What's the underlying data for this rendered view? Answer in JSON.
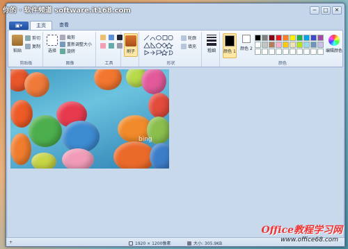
{
  "watermark": {
    "top": "你的 · 软件频道 software.it168.com",
    "brand": "Office教程学习网",
    "url": "www.office68.com"
  },
  "window": {
    "controls": [
      "─",
      "□",
      "✕"
    ]
  },
  "tabs": {
    "menu_label": "▣▾",
    "home": "主页",
    "view": "查看"
  },
  "ribbon": {
    "clipboard": {
      "paste": "粘贴",
      "cut": "剪切",
      "copy": "复制",
      "label": "剪贴板"
    },
    "image": {
      "select": "选择",
      "crop": "裁剪",
      "resize": "重新调整大小",
      "rotate": "旋转",
      "label": "图像"
    },
    "tools": {
      "label": "工具"
    },
    "brushes": {
      "label": "刷子"
    },
    "shapes": {
      "outline": "轮廓",
      "fill": "填充",
      "label": "形状"
    },
    "size": {
      "label": "粗细"
    },
    "colors": {
      "color1": "颜色 1",
      "color2": "颜色 2",
      "edit": "编辑颜色",
      "label": "颜色"
    }
  },
  "palette": [
    "#000000",
    "#7f7f7f",
    "#880015",
    "#ed1c24",
    "#ff7f27",
    "#fff200",
    "#22b14c",
    "#00a2e8",
    "#3f48cc",
    "#a349a4",
    "#ffffff",
    "#c3c3c3",
    "#b97a57",
    "#ffaec9",
    "#ffc90e",
    "#efe4b0",
    "#b5e61d",
    "#99d9ea",
    "#7092be",
    "#c8bfe7",
    "#ffffff",
    "#ffffff",
    "#ffffff",
    "#ffffff",
    "#ffffff",
    "#ffffff",
    "#ffffff",
    "#ffffff",
    "#ffffff",
    "#ffffff"
  ],
  "image": {
    "bing_text": "bing"
  },
  "status": {
    "add_icon": "+",
    "dimensions": "1920 × 1200像素",
    "size": "大小: 305.9KB"
  }
}
